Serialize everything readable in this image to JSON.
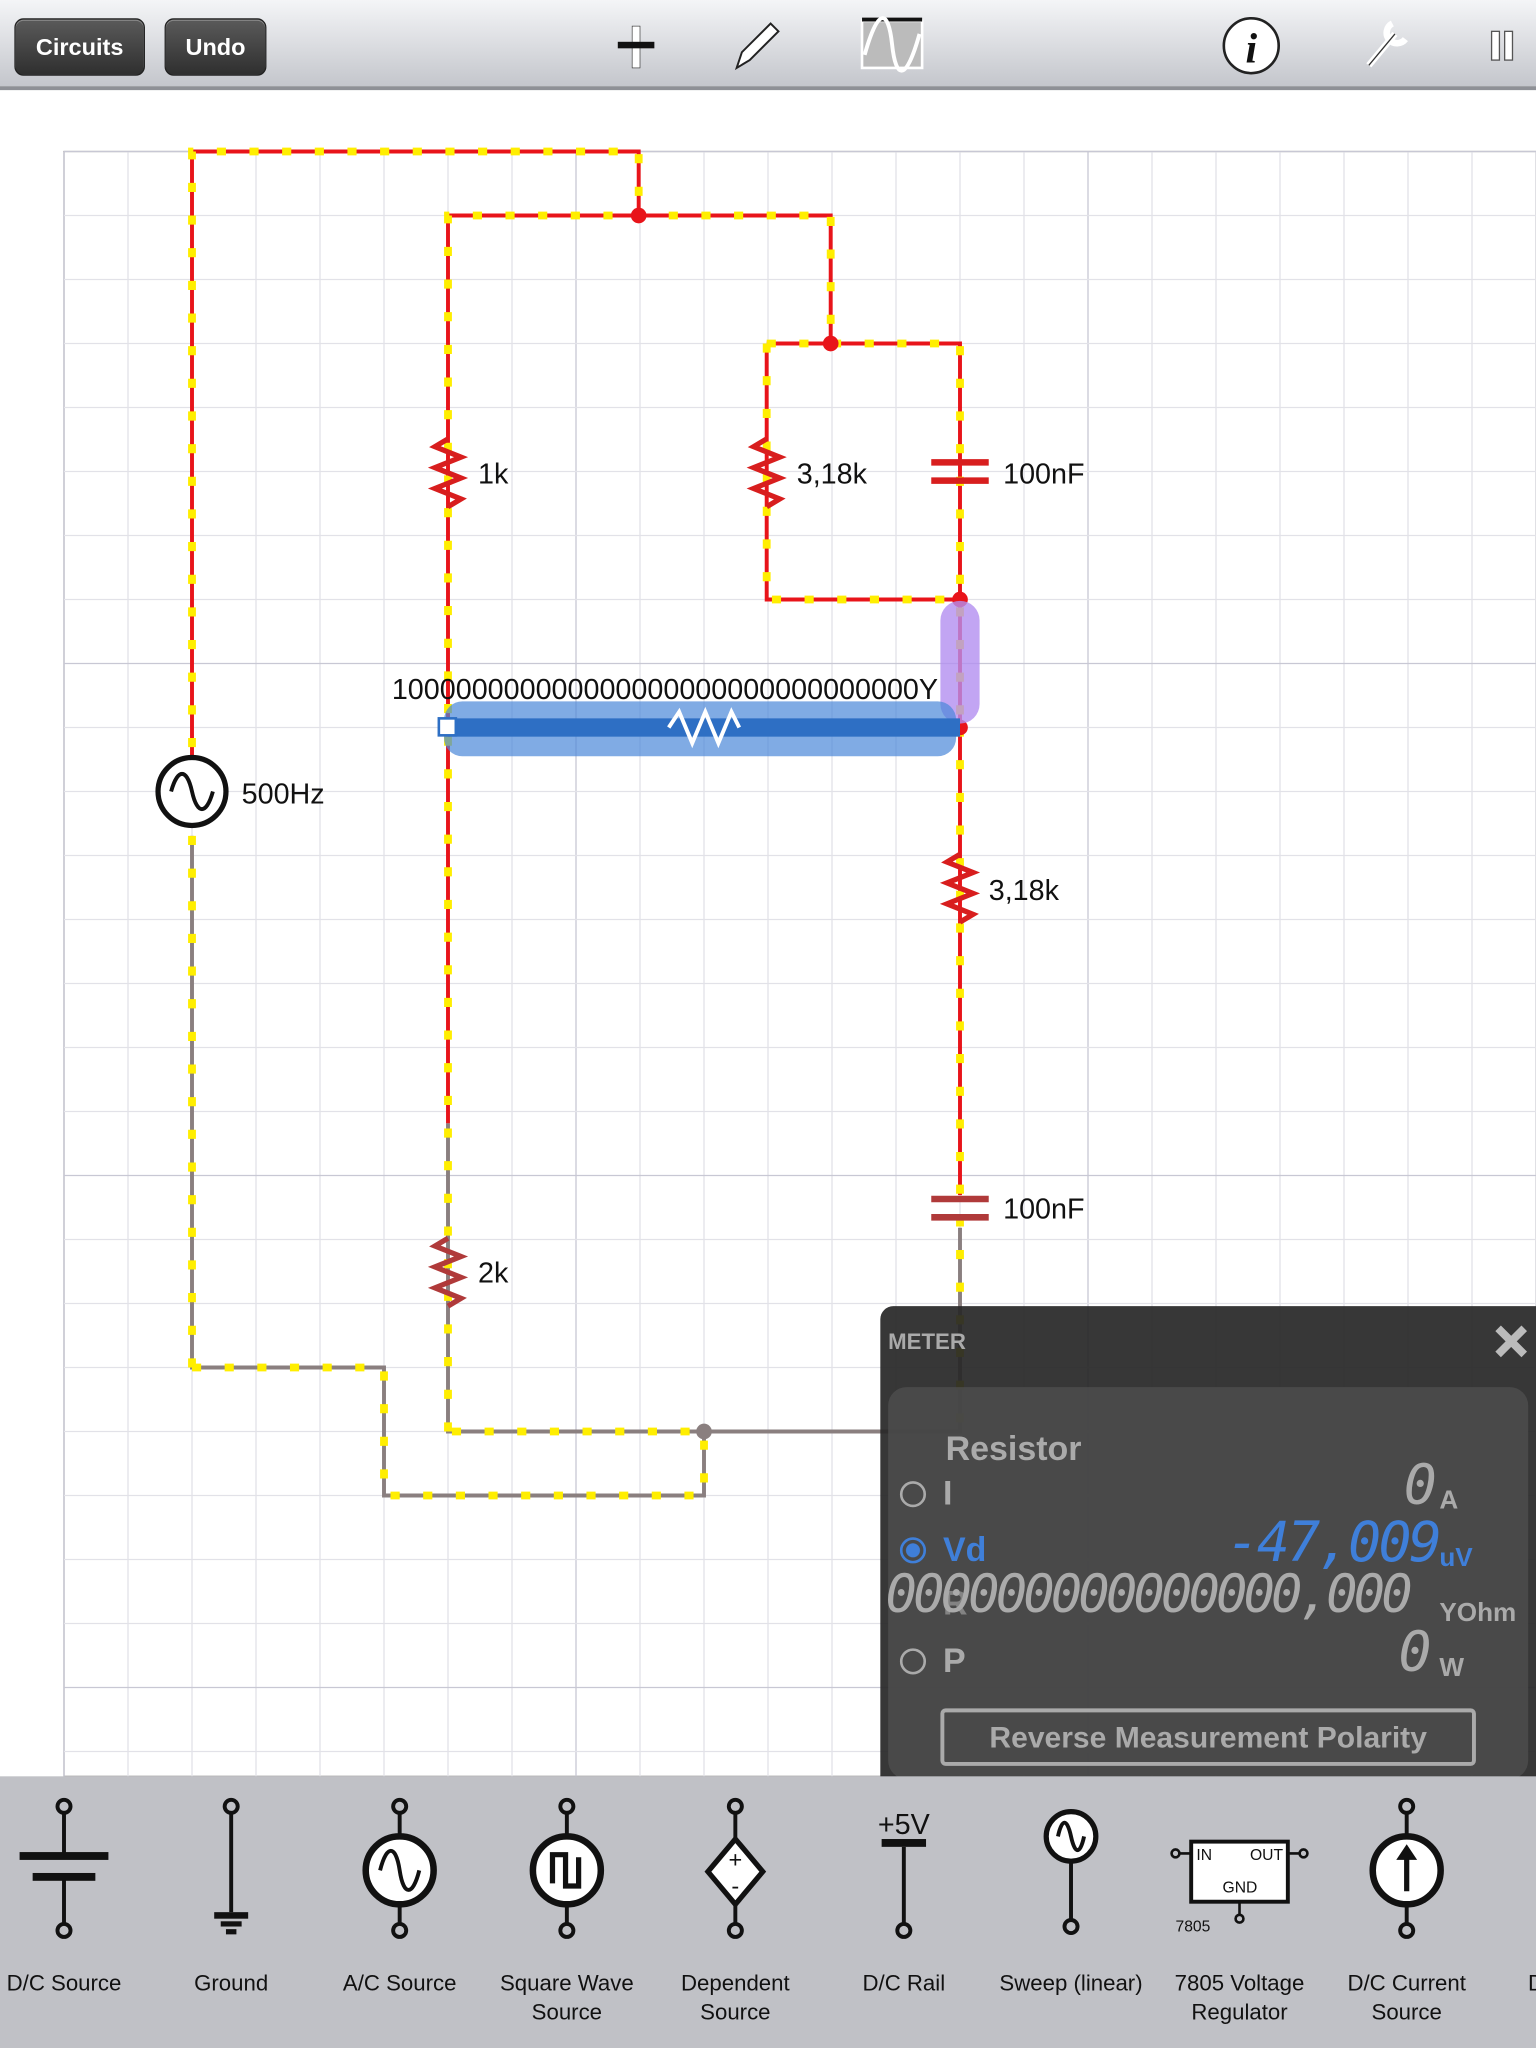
{
  "toolbar": {
    "circuits_label": "Circuits",
    "undo_label": "Undo",
    "icons": [
      "add-icon",
      "pencil-icon",
      "oscilloscope-icon",
      "info-icon",
      "wrench-icon",
      "pause-icon"
    ]
  },
  "circuit": {
    "components": [
      {
        "type": "ac-source",
        "label": "500Hz"
      },
      {
        "type": "resistor",
        "label": "1k"
      },
      {
        "type": "resistor",
        "label": "3,18k"
      },
      {
        "type": "capacitor",
        "label": "100nF"
      },
      {
        "type": "resistor",
        "label": "100000000000000000000000000000000Y",
        "selected": true
      },
      {
        "type": "resistor",
        "label": "3,18k"
      },
      {
        "type": "capacitor",
        "label": "100nF"
      },
      {
        "type": "resistor",
        "label": "2k"
      }
    ],
    "colors": {
      "wire_active": "#e8141a",
      "current_dash": "#ffee00",
      "wire_idle": "#8a7f7f",
      "selection": "#2e6fc4",
      "probe": "#b38ff0"
    }
  },
  "meter": {
    "title": "METER",
    "component": "Resistor",
    "rows": [
      {
        "label": "I",
        "value": "0",
        "unit": "A",
        "selected": false
      },
      {
        "label": "Vd",
        "value": "-47,009",
        "unit": "uV",
        "selected": true
      },
      {
        "label": "R",
        "value": "000000000000000,000",
        "unit": "YOhm",
        "selected": false
      },
      {
        "label": "P",
        "value": "0",
        "unit": "W",
        "selected": false
      }
    ],
    "reverse_label": "Reverse Measurement Polarity",
    "accent": "#3f7fd9"
  },
  "palette": {
    "items": [
      {
        "label": "D/C Source"
      },
      {
        "label": "Ground"
      },
      {
        "label": "A/C Source"
      },
      {
        "label": "Square Wave Source"
      },
      {
        "label": "Dependent Source"
      },
      {
        "label": "D/C Rail",
        "symbol_text": "+5V"
      },
      {
        "label": "Sweep (linear)"
      },
      {
        "label": "7805 Voltage Regulator",
        "symbol_text": "7805",
        "pins": [
          "IN",
          "OUT",
          "GND"
        ]
      },
      {
        "label": "D/C Current Source"
      },
      {
        "label": "D"
      }
    ]
  }
}
